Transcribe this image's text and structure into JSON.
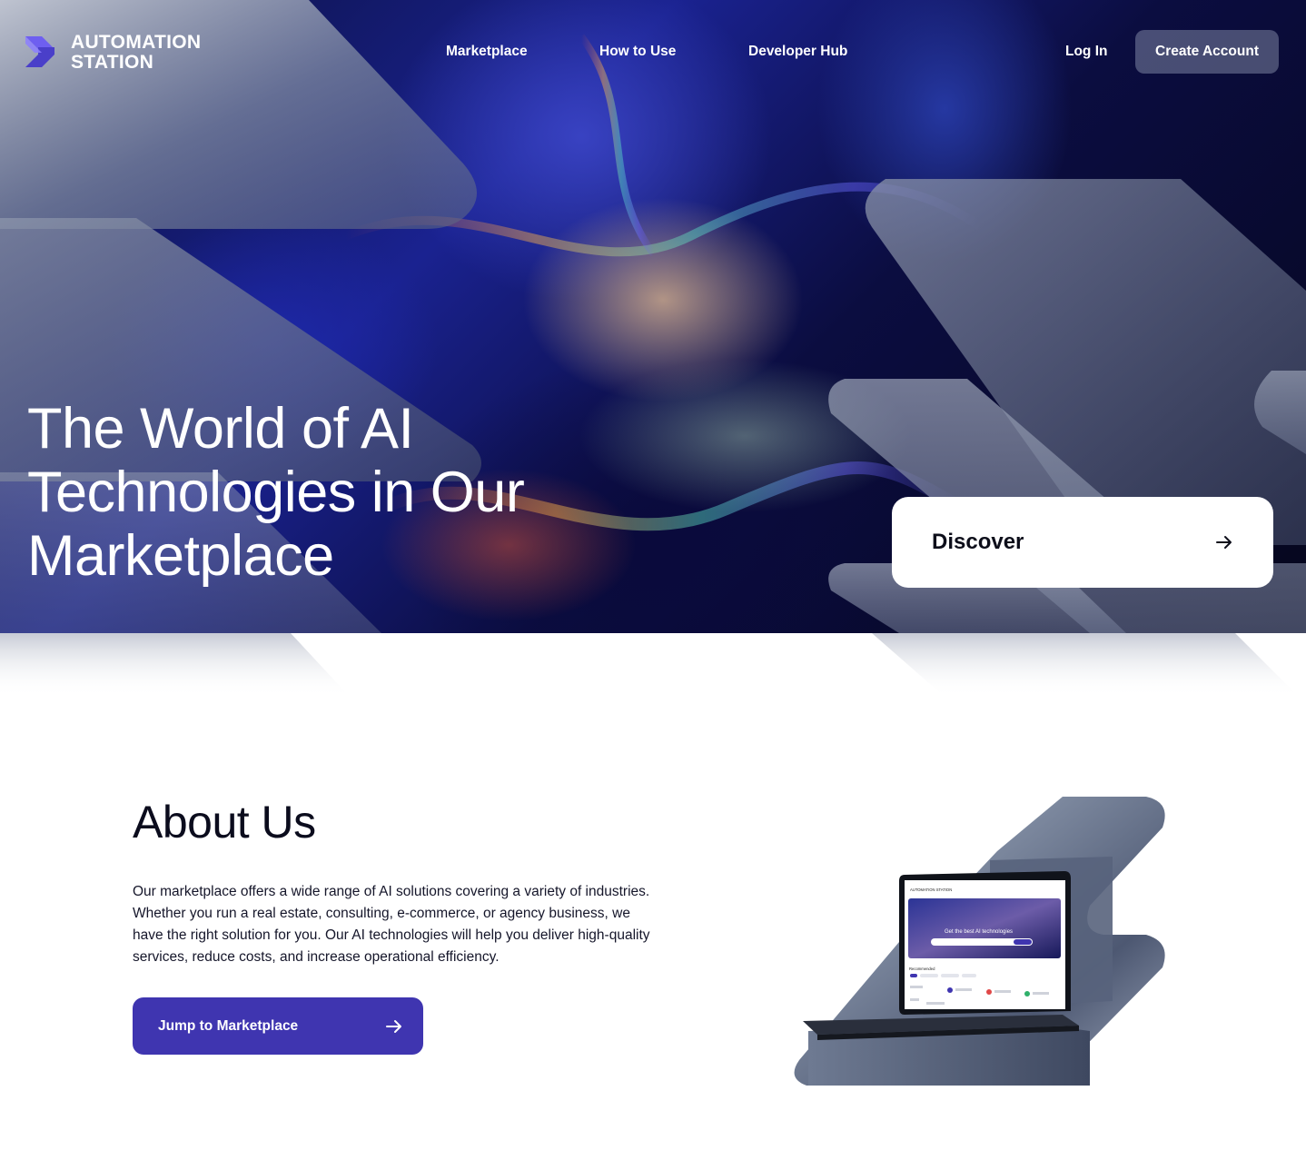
{
  "brand": {
    "name_line1": "AUTOMATION",
    "name_line2": "STATION",
    "accent_color": "#5a4fd6"
  },
  "nav": {
    "items": [
      {
        "label": "Marketplace"
      },
      {
        "label": "How to Use"
      },
      {
        "label": "Developer Hub"
      }
    ],
    "login_label": "Log In",
    "create_account_label": "Create Account"
  },
  "hero": {
    "title": "The World of AI Technologies in Our Marketplace",
    "discover_label": "Discover"
  },
  "about": {
    "title": "About Us",
    "body": "Our marketplace offers a wide range of AI solutions covering a variety of industries. Whether you run a real estate, consulting, e-commerce, or agency business, we have the right solution for you. Our AI technologies will help you deliver high-quality services, reduce costs, and increase operational efficiency.",
    "cta_label": "Jump to Marketplace",
    "cta_color": "#3f35b0"
  },
  "laptop_screen": {
    "brand": "AUTOMATION STATION",
    "headline": "Get the best AI technologies",
    "section": "Recommended"
  },
  "icons": {
    "discover": "arrow-right-icon",
    "cta": "arrow-right-icon",
    "logo": "logo-mark-icon"
  }
}
